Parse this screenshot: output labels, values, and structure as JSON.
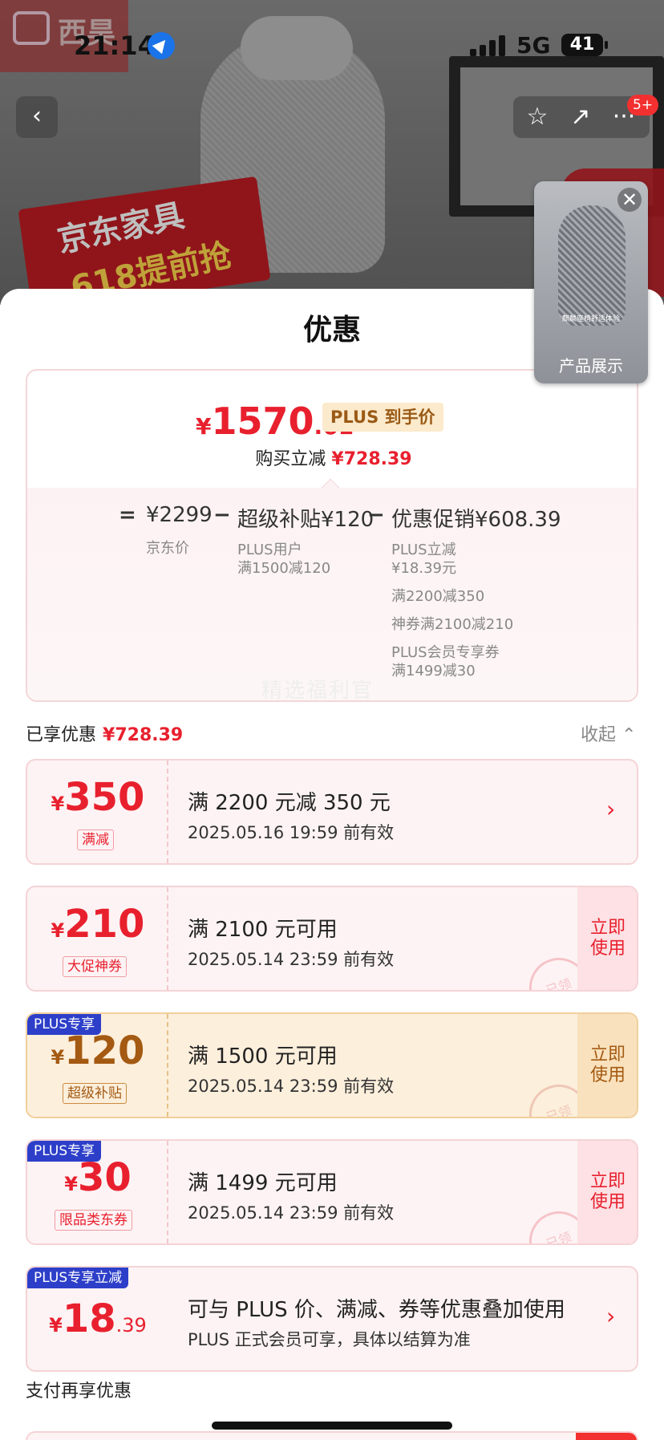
{
  "status": {
    "time": "21:14",
    "network": "5G",
    "battery": "41"
  },
  "hero": {
    "brand": "西昊",
    "promo_line1": "京东家具",
    "promo_line2": "618提前抢"
  },
  "nav": {
    "back_icon": "‹",
    "fav_icon": "☆",
    "share_icon": "↗",
    "more_icon": "···",
    "badge": "5+"
  },
  "float_video": {
    "caption": "麒麟座椅舒适体验",
    "label": "产品展示",
    "close_icon": "✕"
  },
  "sheet": {
    "title": "优惠",
    "final_price": {
      "currency": "¥",
      "integer": "1570",
      "decimal": ".61",
      "tag": "PLUS 到手价"
    },
    "buy_reduce": {
      "label": "购买立减",
      "value": "¥728.39"
    },
    "formula": {
      "equals": "=",
      "minus": "−",
      "jd_price": "¥2299",
      "jd_price_label": "京东价",
      "subsidy": "超级补贴¥120",
      "subsidy_line1": "PLUS用户",
      "subsidy_line2": "满1500减120",
      "promo": "优惠促销¥608.39",
      "promo_details": [
        "PLUS立减",
        "¥18.39元",
        "满2200减350",
        "神券满2100减210",
        "PLUS会员专享券",
        "满1499减30"
      ]
    },
    "watermark": "精选福利官",
    "enjoyed": {
      "label": "已享优惠",
      "value": "¥728.39"
    },
    "collapse": {
      "label": "收起",
      "icon": "⌃"
    },
    "coupons": [
      {
        "currency": "¥",
        "amount": "350",
        "decimal": "",
        "type": "满减",
        "badge": "",
        "title": "满 2200 元减 350 元",
        "validity": "2025.05.16 19:59 前有效",
        "action": "",
        "arrow": "›"
      },
      {
        "currency": "¥",
        "amount": "210",
        "decimal": "",
        "type": "大促神券",
        "badge": "",
        "title": "满 2100 元可用",
        "validity": "2025.05.14 23:59 前有效",
        "action": "立即\n使用",
        "stamp": "已领"
      },
      {
        "currency": "¥",
        "amount": "120",
        "decimal": "",
        "type": "超级补贴",
        "badge": "PLUS专享",
        "title": "满 1500 元可用",
        "validity": "2025.05.14 23:59 前有效",
        "action": "立即\n使用",
        "stamp": "已领"
      },
      {
        "currency": "¥",
        "amount": "30",
        "decimal": "",
        "type": "限品类东券",
        "badge": "PLUS专享",
        "title": "满 1499 元可用",
        "validity": "2025.05.14 23:59 前有效",
        "action": "立即\n使用",
        "stamp": "已领"
      },
      {
        "currency": "¥",
        "amount": "18",
        "decimal": ".39",
        "type": "",
        "badge": "PLUS专享立减",
        "title": "可与 PLUS 价、满减、券等优惠叠加使用",
        "validity": "PLUS 正式会员可享，具体以结算为准",
        "action": "",
        "arrow": "›"
      }
    ],
    "pay_again": "支付再享优惠"
  }
}
